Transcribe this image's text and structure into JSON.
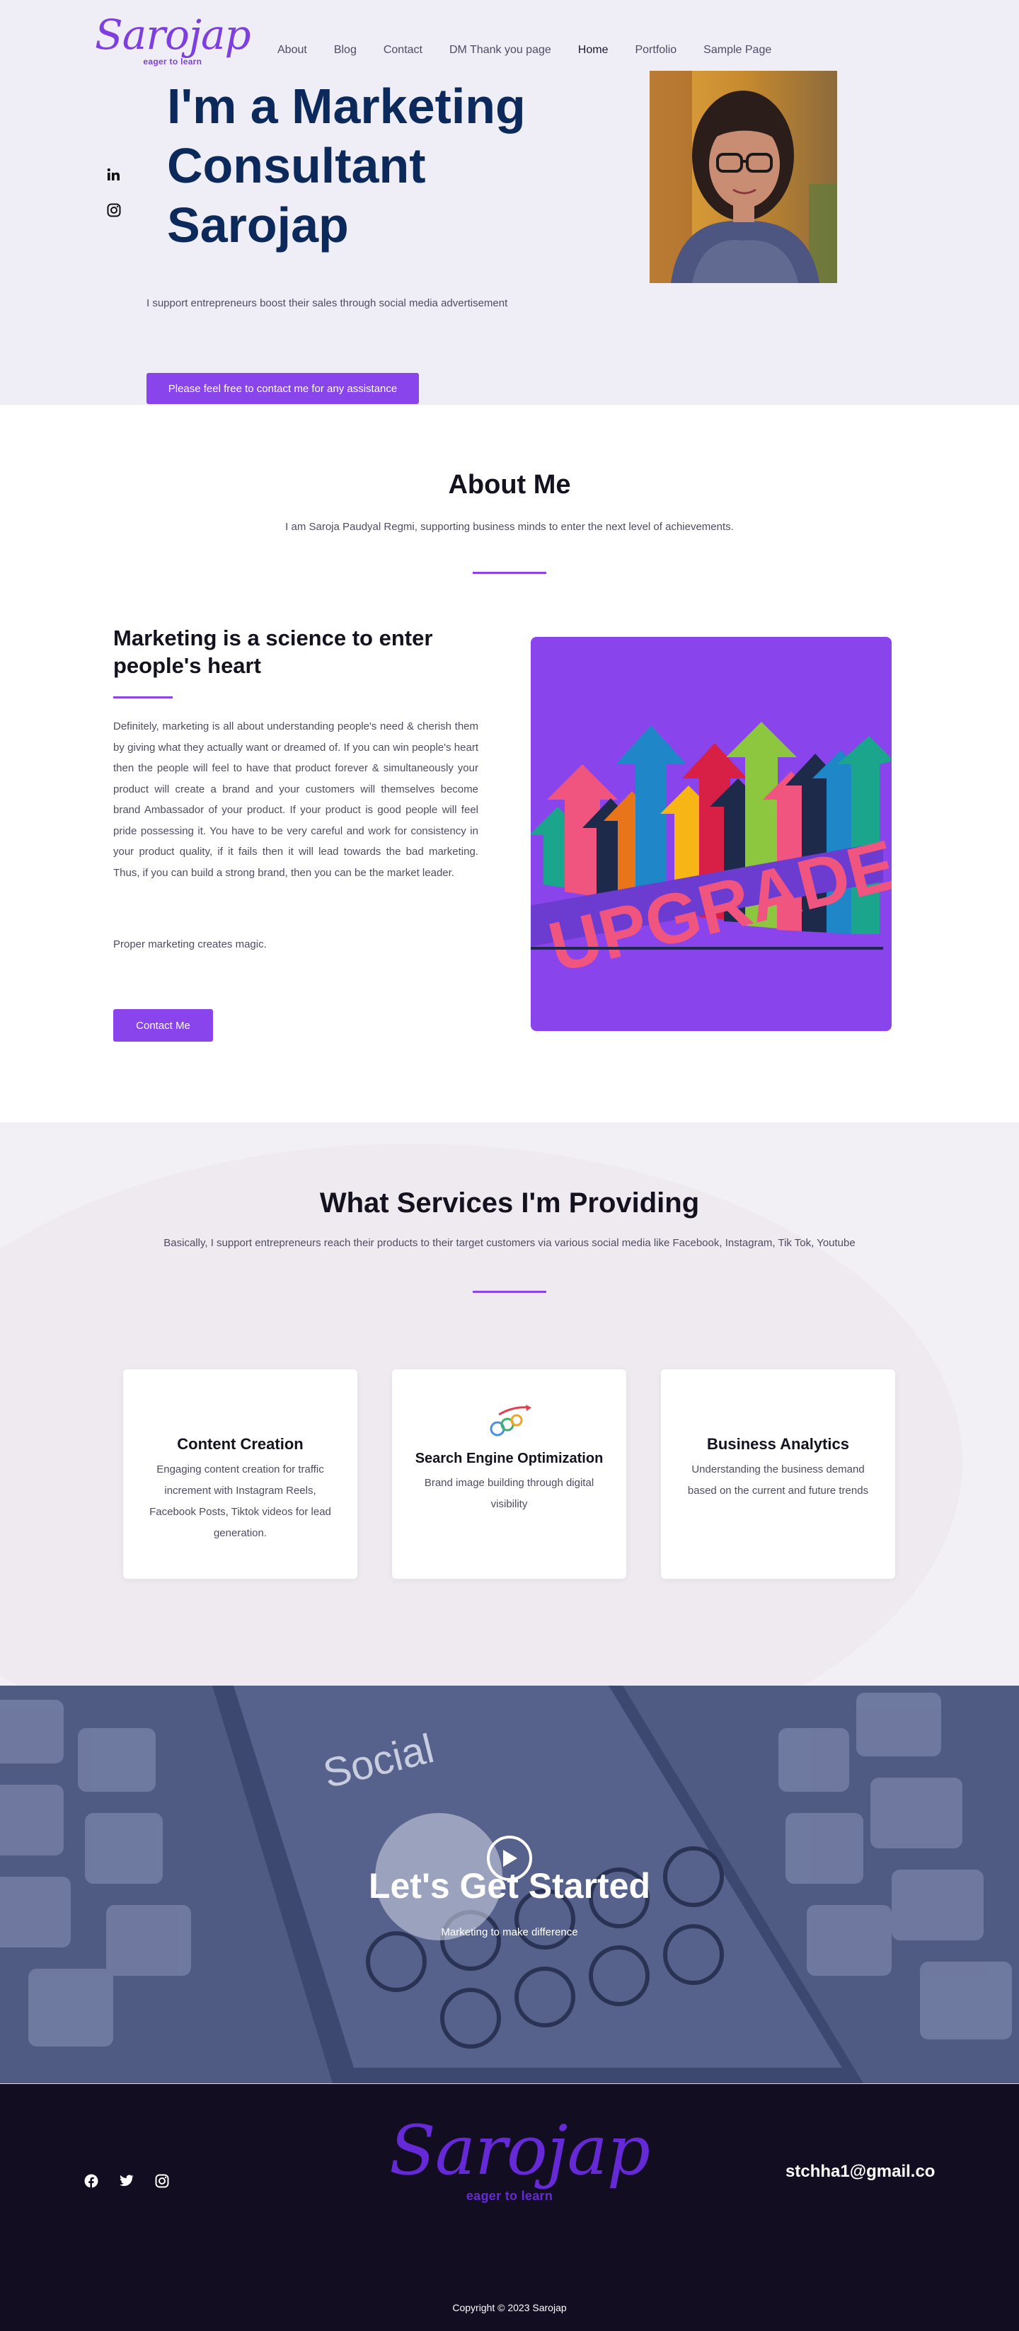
{
  "brand": {
    "name": "Sarojap",
    "tagline": "eager to learn",
    "color": "#7e3fe0"
  },
  "nav": {
    "items": [
      {
        "label": "About"
      },
      {
        "label": "Blog"
      },
      {
        "label": "Contact"
      },
      {
        "label": "DM Thank you page"
      },
      {
        "label": "Home",
        "active": true
      },
      {
        "label": "Portfolio"
      },
      {
        "label": "Sample Page"
      }
    ]
  },
  "hero": {
    "title_lines": [
      "I'm a Marketing",
      "Consultant",
      "Sarojap"
    ],
    "subtitle": "I support entrepreneurs boost their sales through social media advertisement",
    "cta_label": "Please feel free to contact me for any assistance",
    "social_icons": [
      "linkedin-icon",
      "instagram-icon"
    ]
  },
  "about": {
    "heading": "About Me",
    "subheading": "I am Saroja Paudyal Regmi, supporting business minds to enter the next level of achievements.",
    "feature_title": "Marketing is a science to enter people's heart",
    "feature_body": "Definitely, marketing is all about understanding people's need & cherish them by giving what they actually want or dreamed of. If you can win people's heart then the people will feel to have that product forever & simultaneously your product will create a brand and your customers will themselves become brand Ambassador of your product.  If your product is good people will feel pride possessing it.   You have to be very careful and work for consistency in your product quality, if it fails then it will lead towards the bad marketing.  Thus, if you can build a strong brand, then you can be the market leader.",
    "tagline": "Proper marketing creates magic.",
    "button_label": "Contact Me",
    "image_word": "UPGRADE"
  },
  "services": {
    "heading": "What Services I'm Providing",
    "subheading": "Basically, I support entrepreneurs reach their products to their target customers via various social media like Facebook, Instagram, Tik Tok, Youtube",
    "cards": [
      {
        "title": "Content Creation",
        "body": "Engaging content creation for traffic increment with Instagram Reels, Facebook Posts, Tiktok videos for lead generation."
      },
      {
        "title": "Search Engine Optimization",
        "body": "Brand image building through digital visibility"
      },
      {
        "title": "Business Analytics",
        "body": "Understanding the business demand based on the current and future trends"
      }
    ]
  },
  "cta": {
    "title": "Let's Get Started",
    "subtitle": "Marketing to make difference",
    "image_word": "Social"
  },
  "footer": {
    "email": "stchha1@gmail.co",
    "social_icons": [
      "facebook-icon",
      "twitter-icon",
      "instagram-icon"
    ],
    "copyright": "Copyright © 2023 Sarojap"
  },
  "colors": {
    "accent": "#8a44ec",
    "heading_navy": "#0b2a5b",
    "hero_bg": "#efedf5",
    "footer_bg": "#130d21"
  }
}
